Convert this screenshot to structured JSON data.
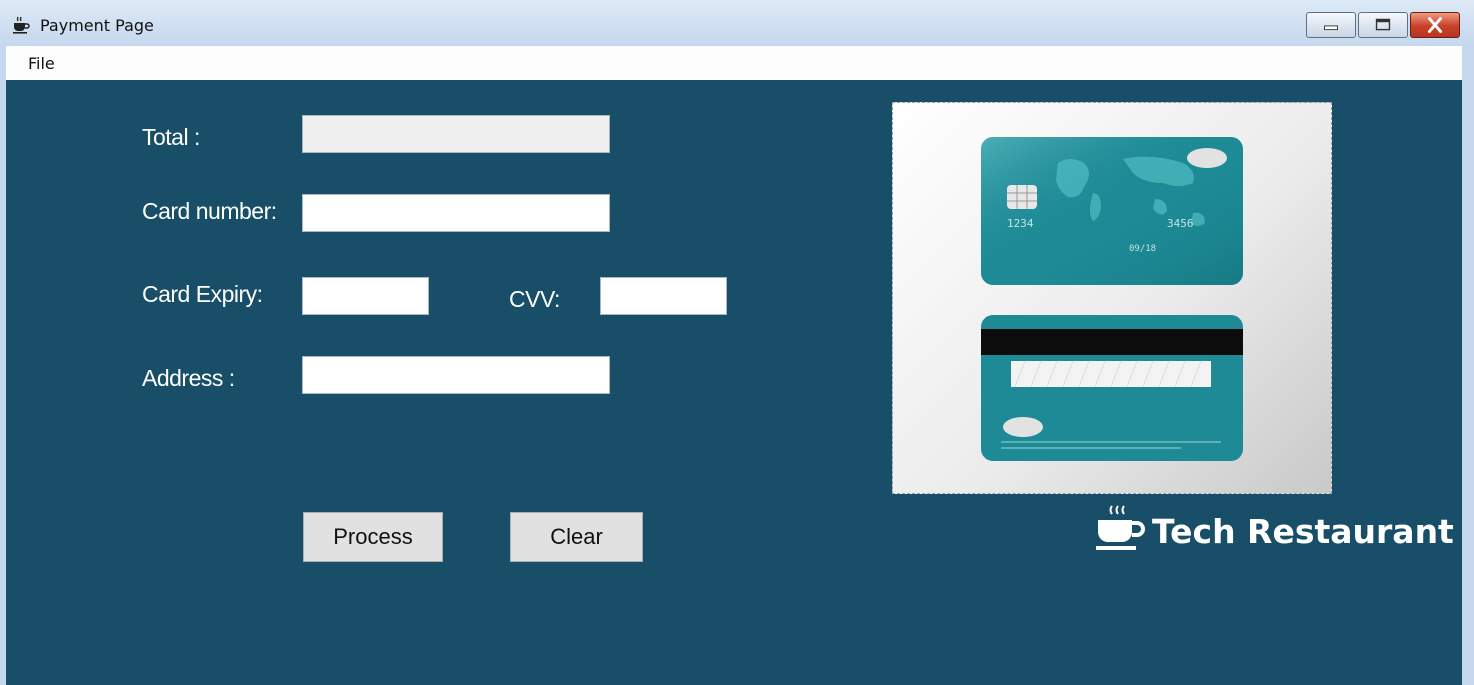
{
  "window": {
    "title": "Payment Page",
    "icon": "coffee-cup-icon",
    "controls": [
      "minimize-icon",
      "maximize-icon",
      "close-icon"
    ]
  },
  "menu": {
    "file": "File"
  },
  "form": {
    "total_label": "Total :",
    "total_value": "",
    "card_number_label": "Card number:",
    "card_number_value": "",
    "card_expiry_label": "Card Expiry:",
    "card_expiry_value": "",
    "cvv_label": "CVV:",
    "cvv_value": "",
    "address_label": "Address :",
    "address_value": ""
  },
  "buttons": {
    "process": "Process",
    "clear": "Clear"
  },
  "brand": {
    "name": "Tech Restaurant",
    "logo_icon": "coffee-cup-icon"
  },
  "colors": {
    "background": "#184e67",
    "card": "#1d8a95",
    "text": "#ffffff"
  }
}
